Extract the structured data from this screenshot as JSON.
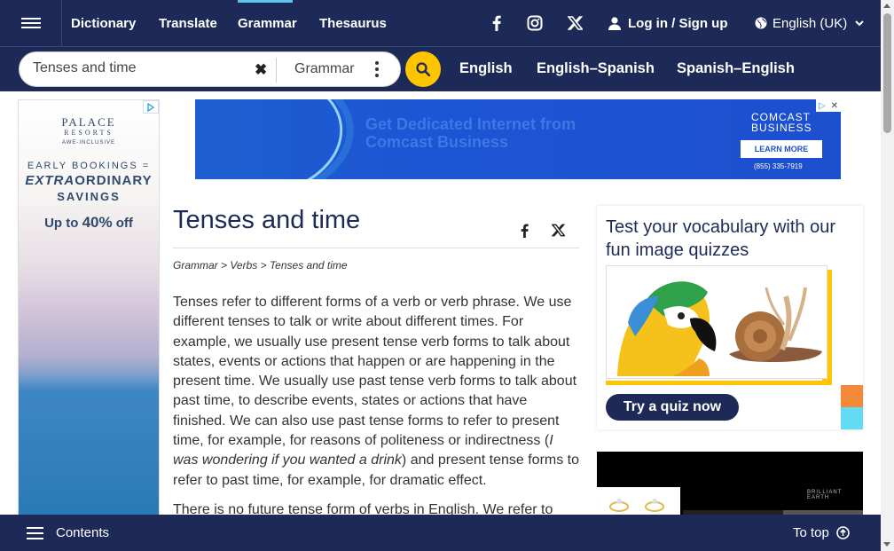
{
  "topnav": {
    "items": [
      {
        "label": "Dictionary"
      },
      {
        "label": "Translate"
      },
      {
        "label": "Grammar",
        "active": true
      },
      {
        "label": "Thesaurus"
      }
    ],
    "social": [
      "facebook-icon",
      "instagram-icon",
      "x-icon"
    ],
    "login_label": "Log in / Sign up",
    "language_label": "English (UK)"
  },
  "search": {
    "value": "Tenses and time",
    "dictionary": "Grammar",
    "links": [
      "English",
      "English–Spanish",
      "Spanish–English"
    ]
  },
  "ads": {
    "left": {
      "brand": "PALACE",
      "brand2": "RESORTS",
      "tagline": "AWE-INCLUSIVE",
      "line1": "EARLY BOOKINGS =",
      "line2a": "EXTRA",
      "line2b": "ORDINARY",
      "line3": "SAVINGS",
      "offer_prefix": "Up to ",
      "offer_value": "40%",
      "offer_suffix": " off"
    },
    "top": {
      "headline1": "Get Dedicated Internet from",
      "headline2": "Comcast Business",
      "brand1": "COMCAST",
      "brand2": "BUSINESS",
      "cta": "LEARN MORE",
      "phone": "(855) 335-7919"
    },
    "side": {
      "brand": "BRILLIANT EARTH"
    }
  },
  "article": {
    "title": "Tenses and time",
    "breadcrumb": [
      "Grammar",
      "Verbs",
      "Tenses and time"
    ],
    "breadcrumb_sep": " > ",
    "p1_a": "Tenses refer to different forms of a verb or verb phrase. We use different tenses to talk or write about different times. For example, we usually use present tense verb forms to talk about states, events or actions that happen or are happening in the present time. We usually use past tense verb forms to talk about past time, to describe events, states or actions that have finished. We can also use past tense forms to refer to present time, for example, for reasons of politeness or indirectness (",
    "p1_italic": "I was wondering if you wanted a drink",
    "p1_b": ") and present tense forms to refer to past time, for example, for dramatic effect.",
    "p2": "There is no future tense form of verbs in English. We refer to"
  },
  "quiz": {
    "title": "Test your vocabulary with our fun image quizzes",
    "button": "Try a quiz now"
  },
  "bottom": {
    "contents_label": "Contents",
    "totop_label": "To top"
  }
}
